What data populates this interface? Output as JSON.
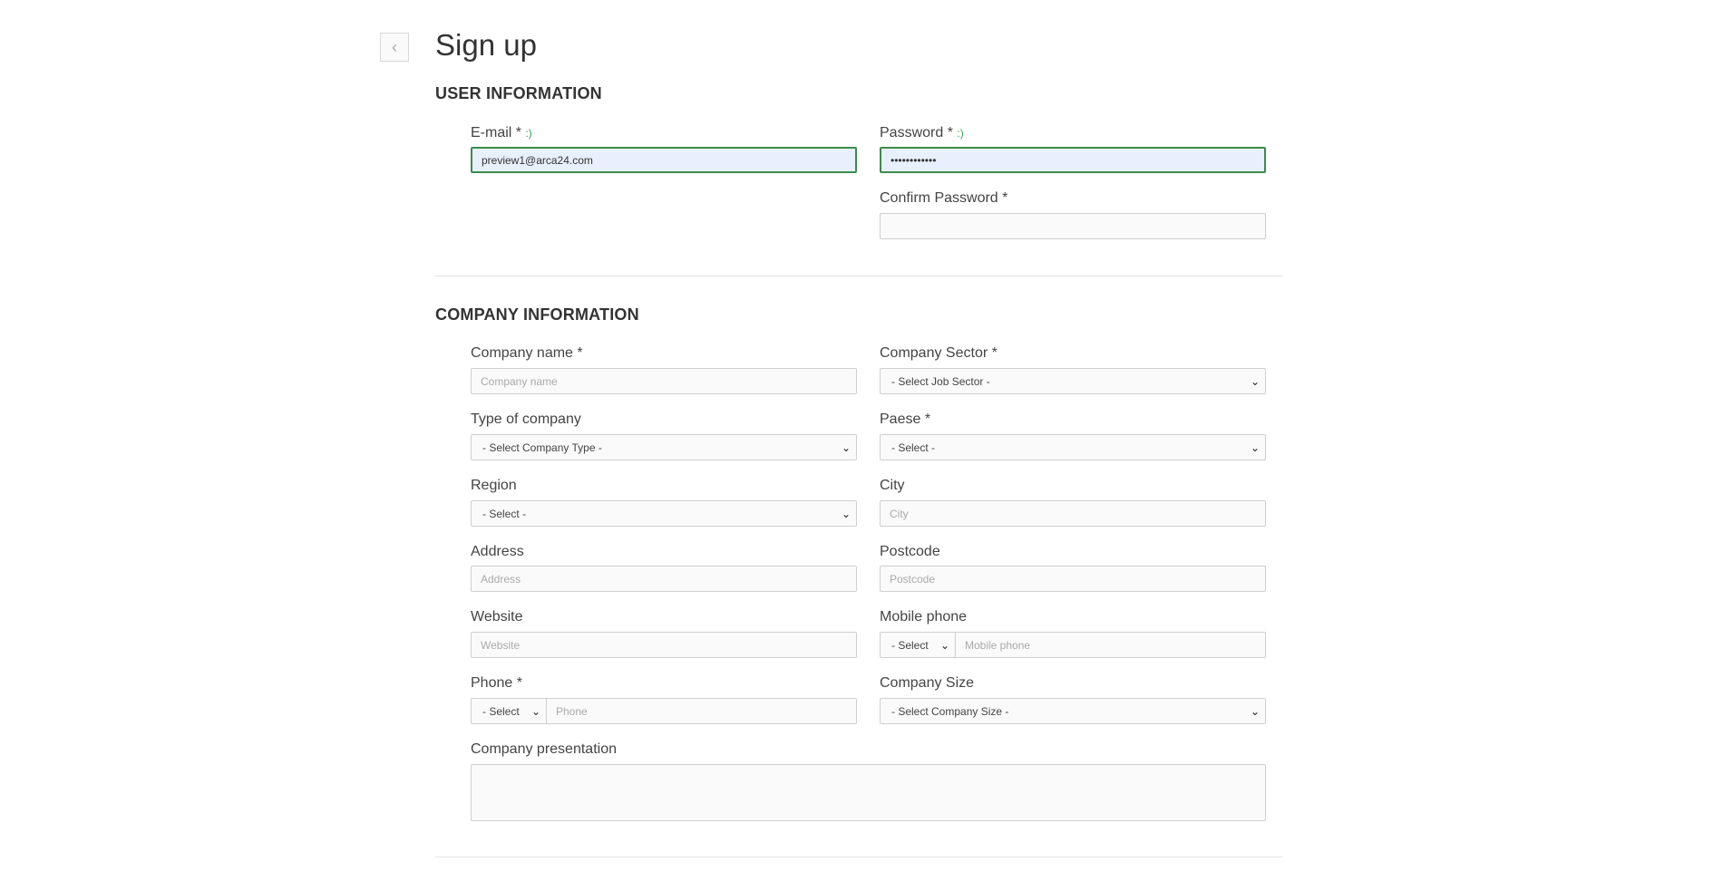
{
  "page": {
    "title": "Sign up",
    "back_icon": "chevron-left-icon"
  },
  "user_section": {
    "title": "USER INFORMATION",
    "email": {
      "label": "E-mail *",
      "hint": ":)",
      "value": "preview1@arca24.com"
    },
    "password": {
      "label": "Password *",
      "hint": ":)",
      "value": "••••••••••••"
    },
    "confirm_password": {
      "label": "Confirm Password *",
      "value": ""
    }
  },
  "company_section": {
    "title": "COMPANY INFORMATION",
    "company_name": {
      "label": "Company name *",
      "placeholder": "Company name"
    },
    "company_sector": {
      "label": "Company Sector *",
      "selected": "- Select Job Sector -"
    },
    "company_type": {
      "label": "Type of company",
      "selected": "- Select Company Type -"
    },
    "country": {
      "label": "Paese *",
      "selected": "- Select -"
    },
    "region": {
      "label": "Region",
      "selected": "- Select -"
    },
    "city": {
      "label": "City",
      "placeholder": "City"
    },
    "address": {
      "label": "Address",
      "placeholder": "Address"
    },
    "postcode": {
      "label": "Postcode",
      "placeholder": "Postcode"
    },
    "website": {
      "label": "Website",
      "placeholder": "Website"
    },
    "mobile_phone": {
      "label": "Mobile phone",
      "prefix_selected": "- Select",
      "placeholder": "Mobile phone"
    },
    "phone": {
      "label": "Phone *",
      "prefix_selected": "- Select",
      "placeholder": "Phone"
    },
    "company_size": {
      "label": "Company Size",
      "selected": "- Select Company Size -"
    },
    "presentation": {
      "label": "Company presentation",
      "placeholder": ""
    }
  }
}
